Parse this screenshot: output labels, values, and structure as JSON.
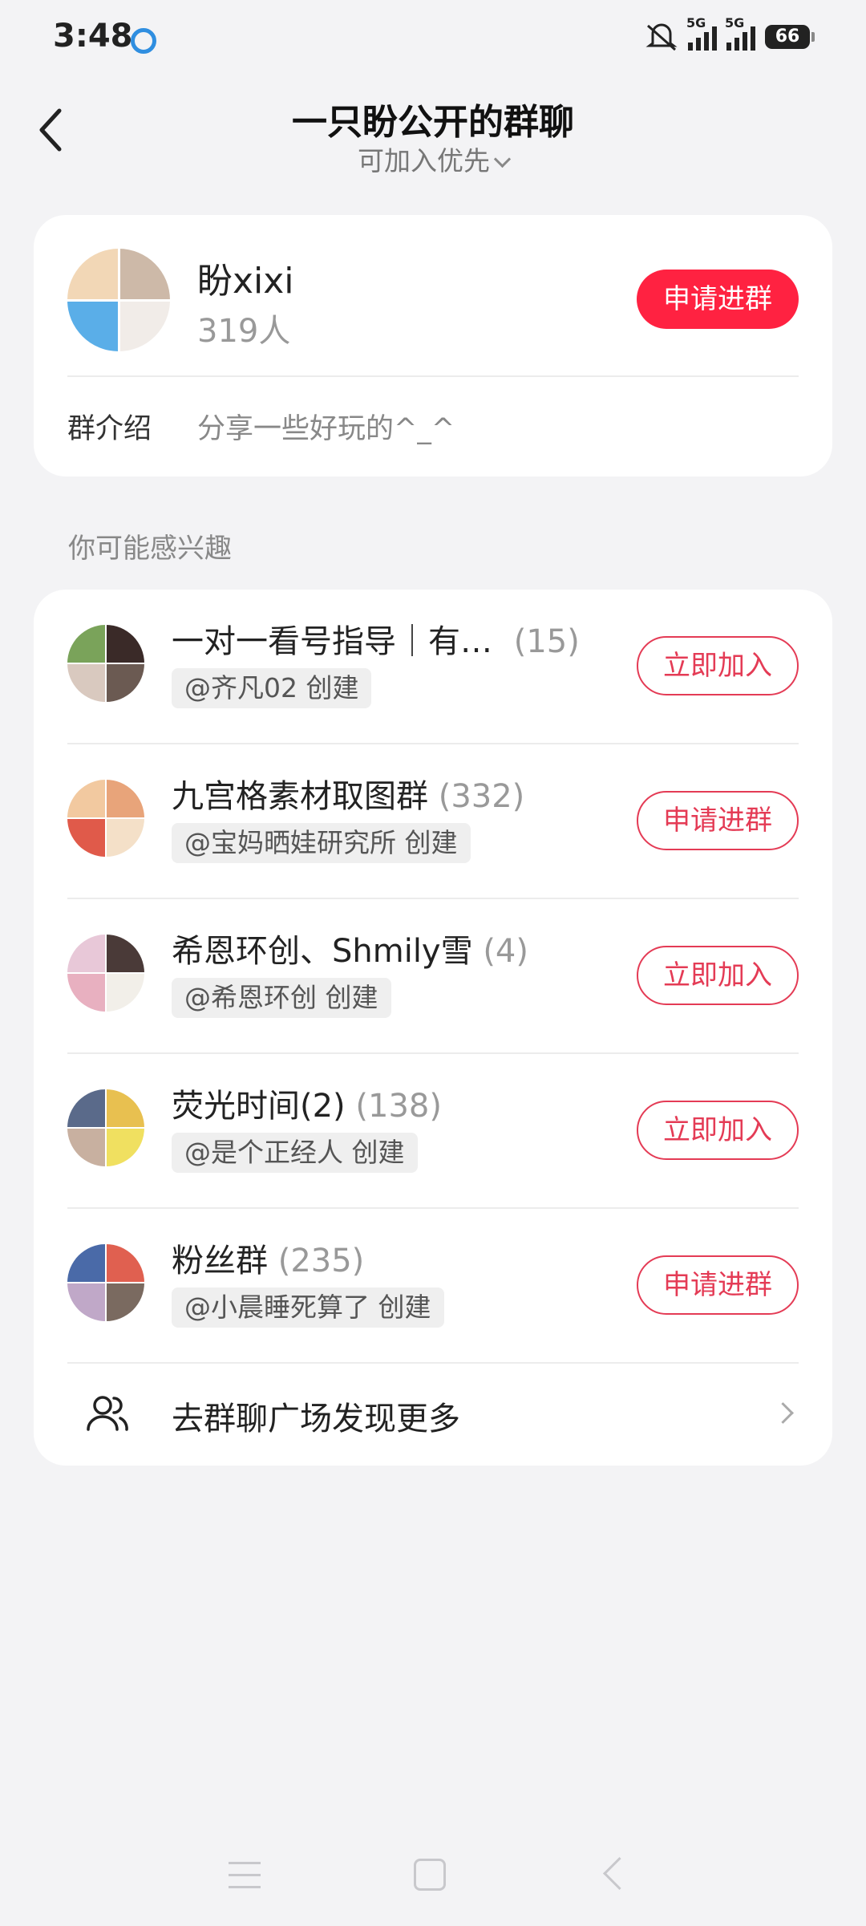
{
  "status": {
    "time": "3:48",
    "sim1_label": "5G",
    "sim2_label": "5G",
    "battery": "66"
  },
  "header": {
    "title": "一只盼公开的群聊",
    "subtitle": "可加入优先"
  },
  "group": {
    "name": "盼xixi",
    "members": "319人",
    "join_button": "申请进群",
    "intro_label": "群介绍",
    "intro_text": "分享一些好玩的^_^"
  },
  "section_label": "你可能感兴趣",
  "recommendations": [
    {
      "name": "一对一看号指导｜有…",
      "count": "(15)",
      "creator": "@齐凡02 创建",
      "button": "立即加入"
    },
    {
      "name": "九宫格素材取图群",
      "count": "(332)",
      "creator": "@宝妈晒娃研究所 创建",
      "button": "申请进群"
    },
    {
      "name": "希恩环创、Shmily雪",
      "count": "(4)",
      "creator": "@希恩环创 创建",
      "button": "立即加入"
    },
    {
      "name": "荧光时间(2)",
      "count": "(138)",
      "creator": "@是个正经人 创建",
      "button": "立即加入"
    },
    {
      "name": "粉丝群",
      "count": "(235)",
      "creator": "@小晨睡死算了 创建",
      "button": "申请进群"
    }
  ],
  "more": {
    "label": "去群聊广场发现更多"
  },
  "colors": {
    "accent": "#ff2241",
    "outline": "#e43b55",
    "background": "#f3f3f5"
  }
}
